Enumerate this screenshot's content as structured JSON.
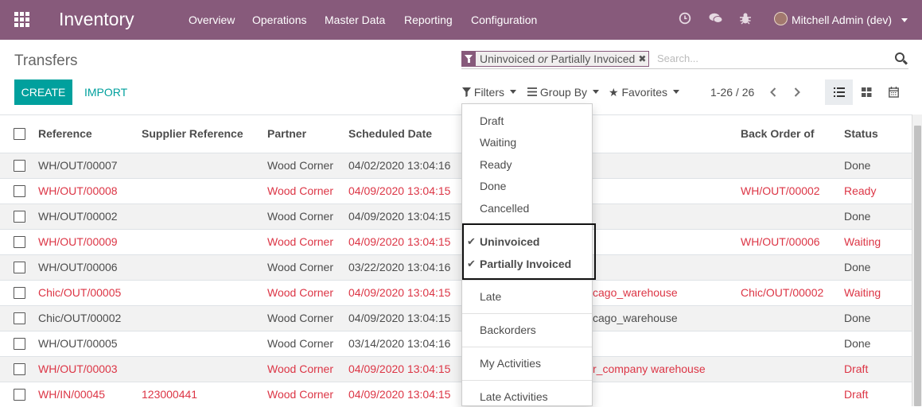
{
  "app": {
    "title": "Inventory"
  },
  "nav": {
    "menus": [
      "Overview",
      "Operations",
      "Master Data",
      "Reporting",
      "Configuration"
    ],
    "user": "Mitchell Admin (dev)"
  },
  "page": {
    "title": "Transfers"
  },
  "buttons": {
    "create": "CREATE",
    "import": "IMPORT"
  },
  "search": {
    "facet_part1": "Uninvoiced",
    "facet_or": "or",
    "facet_part2": "Partially Invoiced",
    "placeholder": "Search..."
  },
  "search_tools": {
    "filters": "Filters",
    "group_by": "Group By",
    "favorites": "Favorites"
  },
  "pager": {
    "range": "1-26 / 26"
  },
  "table": {
    "columns": [
      "Reference",
      "Supplier Reference",
      "Partner",
      "Scheduled Date",
      "Back Order of",
      "Status"
    ],
    "rows": [
      {
        "reference": "WH/OUT/00007",
        "supplier_ref": "",
        "partner": "Wood Corner",
        "date": "04/02/2020 13:04:16",
        "extra": "",
        "back_order": "",
        "status": "Done",
        "red": false
      },
      {
        "reference": "WH/OUT/00008",
        "supplier_ref": "",
        "partner": "Wood Corner",
        "date": "04/09/2020 13:04:15",
        "extra": "",
        "back_order": "WH/OUT/00002",
        "status": "Ready",
        "red": true
      },
      {
        "reference": "WH/OUT/00002",
        "supplier_ref": "",
        "partner": "Wood Corner",
        "date": "04/09/2020 13:04:15",
        "extra": "",
        "back_order": "",
        "status": "Done",
        "red": false
      },
      {
        "reference": "WH/OUT/00009",
        "supplier_ref": "",
        "partner": "Wood Corner",
        "date": "04/09/2020 13:04:15",
        "extra": "",
        "back_order": "WH/OUT/00006",
        "status": "Waiting",
        "red": true
      },
      {
        "reference": "WH/OUT/00006",
        "supplier_ref": "",
        "partner": "Wood Corner",
        "date": "03/22/2020 13:04:16",
        "extra": "",
        "back_order": "",
        "status": "Done",
        "red": false
      },
      {
        "reference": "Chic/OUT/00005",
        "supplier_ref": "",
        "partner": "Wood Corner",
        "date": "04/09/2020 13:04:15",
        "extra": "cago_warehouse",
        "back_order": "Chic/OUT/00002",
        "status": "Waiting",
        "red": true
      },
      {
        "reference": "Chic/OUT/00002",
        "supplier_ref": "",
        "partner": "Wood Corner",
        "date": "04/09/2020 13:04:15",
        "extra": "cago_warehouse",
        "back_order": "",
        "status": "Done",
        "red": false
      },
      {
        "reference": "WH/OUT/00005",
        "supplier_ref": "",
        "partner": "Wood Corner",
        "date": "03/14/2020 13:04:16",
        "extra": "",
        "back_order": "",
        "status": "Done",
        "red": false
      },
      {
        "reference": "WH/OUT/00003",
        "supplier_ref": "",
        "partner": "Wood Corner",
        "date": "04/09/2020 13:04:15",
        "extra": "r_company warehouse",
        "back_order": "",
        "status": "Draft",
        "red": true
      },
      {
        "reference": "WH/IN/00045",
        "supplier_ref": "123000441",
        "partner": "Wood Corner",
        "date": "04/09/2020 13:04:15",
        "extra": "",
        "back_order": "",
        "status": "Draft",
        "red": true
      }
    ]
  },
  "filters_menu": {
    "states": [
      "Draft",
      "Waiting",
      "Ready",
      "Done",
      "Cancelled"
    ],
    "invoice": [
      "Uninvoiced",
      "Partially Invoiced"
    ],
    "late": "Late",
    "backorders": "Backorders",
    "my_activities": "My Activities",
    "late_activities": "Late Activities"
  },
  "colors": {
    "brand": "#875a7b",
    "primary": "#00a09d",
    "danger": "#dc3545"
  }
}
